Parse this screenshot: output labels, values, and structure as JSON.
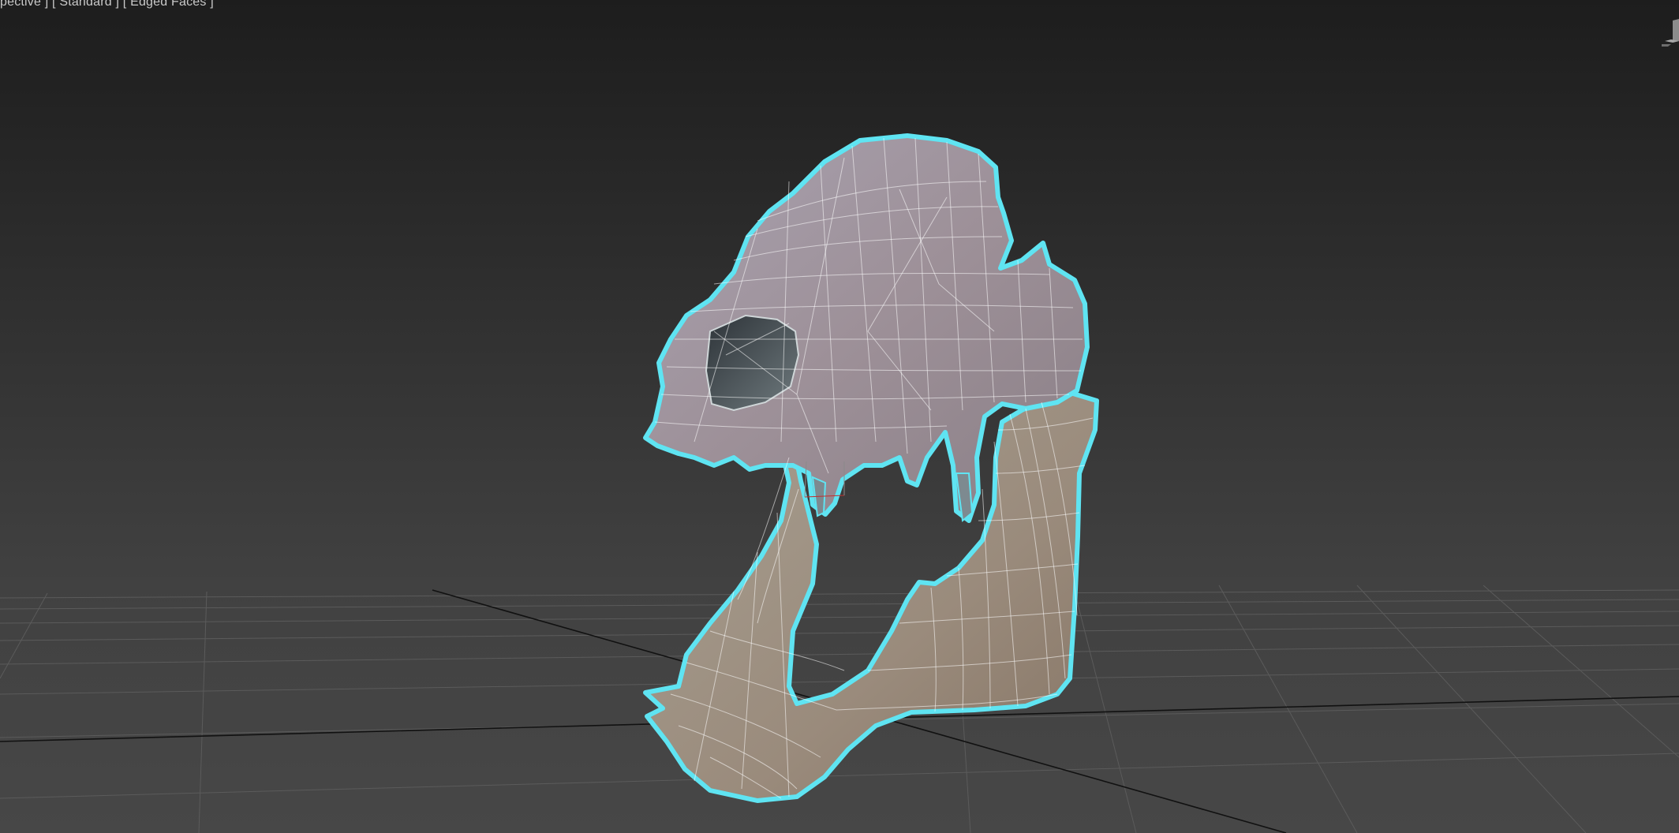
{
  "viewport": {
    "label": "[ Perspective ] [ Standard ] [ Edged Faces ]",
    "label_prefix": "[ ",
    "label_visible": "pective ] [ Standard ] [ Edged Faces ]",
    "background_top": "#1d1d1d",
    "background_bottom": "#474747",
    "grid_color": "#5b5b5b",
    "axis_color": "#111111",
    "selection_outline_color": "#5fe4f2",
    "wireframe_color": "#ffffff",
    "model_name": "animal skull",
    "model_state": "selected"
  },
  "viewcube": {
    "icon": "viewcube-icon"
  }
}
